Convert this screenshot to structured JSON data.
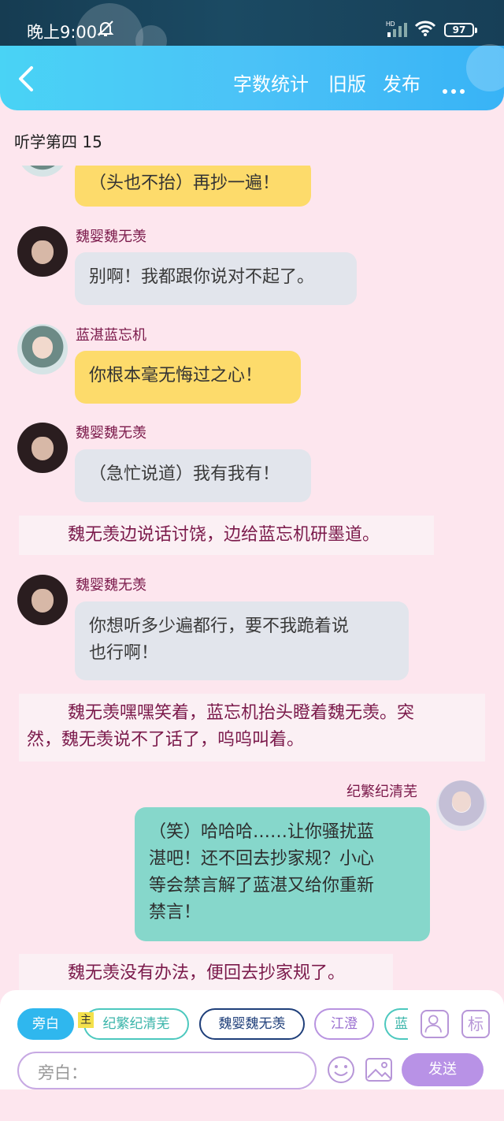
{
  "status_bar": {
    "time": "晚上9:00",
    "battery": "97",
    "network": "HD"
  },
  "header": {
    "word_count": "字数统计",
    "old_version": "旧版",
    "publish": "发布"
  },
  "chapter_title": "听学第四 15",
  "messages": [
    {
      "type": "bubble",
      "speaker": "",
      "text": "（头也不抬）再抄一遍！"
    },
    {
      "type": "bubble",
      "speaker": "魏婴魏无羡",
      "text": "别啊！我都跟你说对不起了。"
    },
    {
      "type": "bubble",
      "speaker": "蓝湛蓝忘机",
      "text": "你根本毫无悔过之心！"
    },
    {
      "type": "bubble",
      "speaker": "魏婴魏无羡",
      "text": "（急忙说道）我有我有！"
    },
    {
      "type": "narration",
      "text": "魏无羡边说话讨饶，边给蓝忘机研墨道。"
    },
    {
      "type": "bubble",
      "speaker": "魏婴魏无羡",
      "text_line1": "你想听多少遍都行，要不我跪着说",
      "text_line2": "也行啊！"
    },
    {
      "type": "narration",
      "text_line1": "魏无羡嘿嘿笑着，蓝忘机抬头瞪着魏无羡。突",
      "text_line2": "然，魏无羡说不了话了，呜呜叫着。"
    },
    {
      "type": "bubble",
      "speaker": "纪繁纪清芜",
      "text_line1": "（笑）哈哈哈……让你骚扰蓝",
      "text_line2": "湛吧！还不回去抄家规？小心",
      "text_line3": "等会禁言解了蓝湛又给你重新",
      "text_line4": "禁言！"
    },
    {
      "type": "narration",
      "text": "魏无羡没有办法，便回去抄家规了。"
    }
  ],
  "roles": [
    {
      "label": "旁白",
      "active": true
    },
    {
      "label": "纪繁纪清芜",
      "tag": "主"
    },
    {
      "label": "魏婴魏无羡"
    },
    {
      "label": "江澄"
    },
    {
      "label": "蓝"
    }
  ],
  "tag_button": "标",
  "input": {
    "placeholder": "旁白："
  },
  "send_label": "发送",
  "colors": {
    "header": "#4bc2f7",
    "background": "#fde6ee",
    "narration_text": "#7b1a4b",
    "send": "#b892e6"
  }
}
